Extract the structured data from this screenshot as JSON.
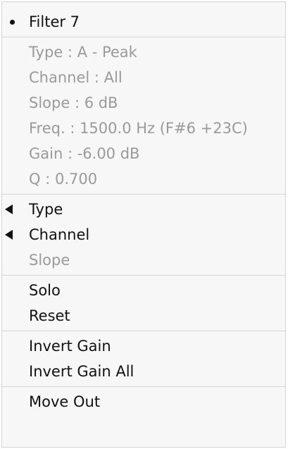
{
  "menu": {
    "header": "Filter 7",
    "info": [
      "Type : A - Peak",
      "Channel : All",
      "Slope :  6 dB",
      "Freq. : 1500.0 Hz (F#6 +23C)",
      "Gain : -6.00 dB",
      "Q : 0.700"
    ],
    "submenus": {
      "type": "Type",
      "channel": "Channel",
      "slope": "Slope"
    },
    "actions": {
      "solo": "Solo",
      "reset": "Reset",
      "invert_gain": "Invert Gain",
      "invert_gain_all": "Invert Gain All",
      "move_out": "Move Out"
    }
  }
}
